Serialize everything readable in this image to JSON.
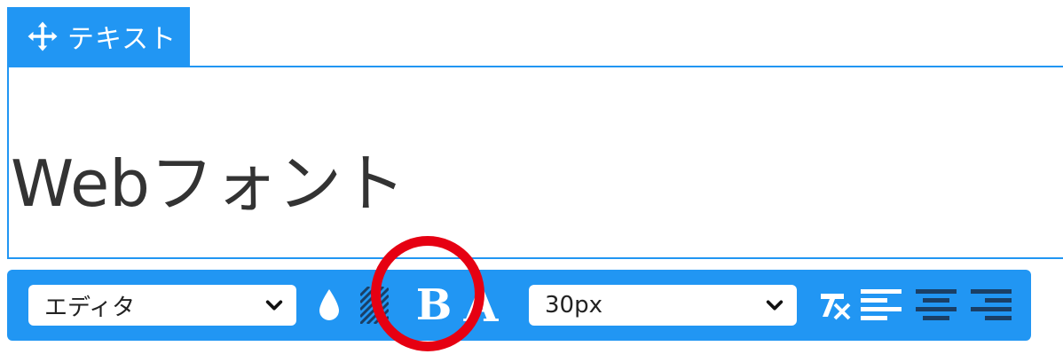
{
  "block": {
    "tab_label": "テキスト",
    "content_text": "Webフォント"
  },
  "toolbar": {
    "font_select_value": "エディタ",
    "size_select_value": "30px",
    "icons": [
      "move-icon",
      "drop-icon",
      "hatch-icon",
      "bold-icon",
      "text-a-icon",
      "clear-format-icon",
      "align-left-icon",
      "align-center-icon",
      "align-right-icon"
    ],
    "bold_glyph": "B",
    "a_glyph": "A"
  },
  "colors": {
    "accent": "#2196f3",
    "highlight": "#e60012",
    "text": "#333333"
  }
}
